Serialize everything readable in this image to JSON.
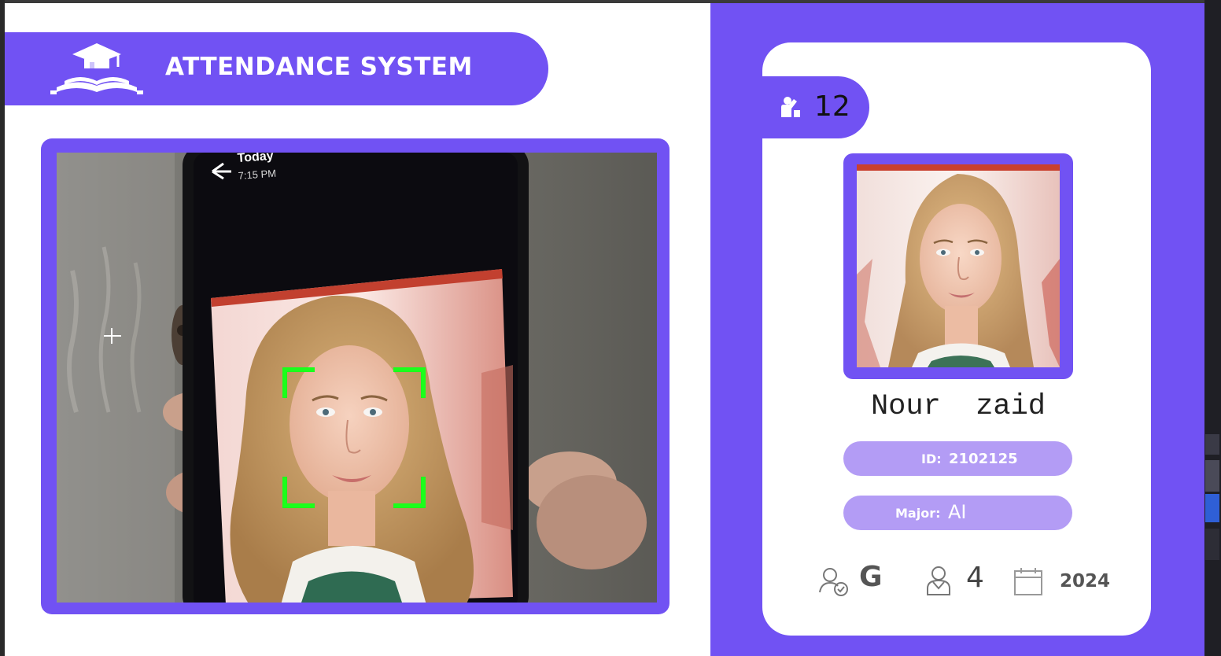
{
  "header": {
    "title": "ATTENDANCE SYSTEM",
    "logo_icon": "graduation-cap-book-icon"
  },
  "camera": {
    "phone_screen": {
      "back_icon": "arrow-left-icon",
      "header_title": "Today",
      "header_time": "7:15 PM"
    },
    "face_box_color": "#1bff1b"
  },
  "student": {
    "attendance_count": "12",
    "attendance_icon": "raised-hand-person-icon",
    "name": "Nour  zaid",
    "id_label": "ID:",
    "id_value": "2102125",
    "major_label": "Major:",
    "major_value": "AI",
    "standing_icon": "user-check-icon",
    "standing": "G",
    "year_icon": "student-icon",
    "year": "4",
    "starting_year_icon": "calendar-icon",
    "starting_year": "2024"
  },
  "colors": {
    "accent": "#7152f3",
    "accent_light": "#b39cf5",
    "text_dark": "#222222",
    "text_muted": "#555555"
  }
}
